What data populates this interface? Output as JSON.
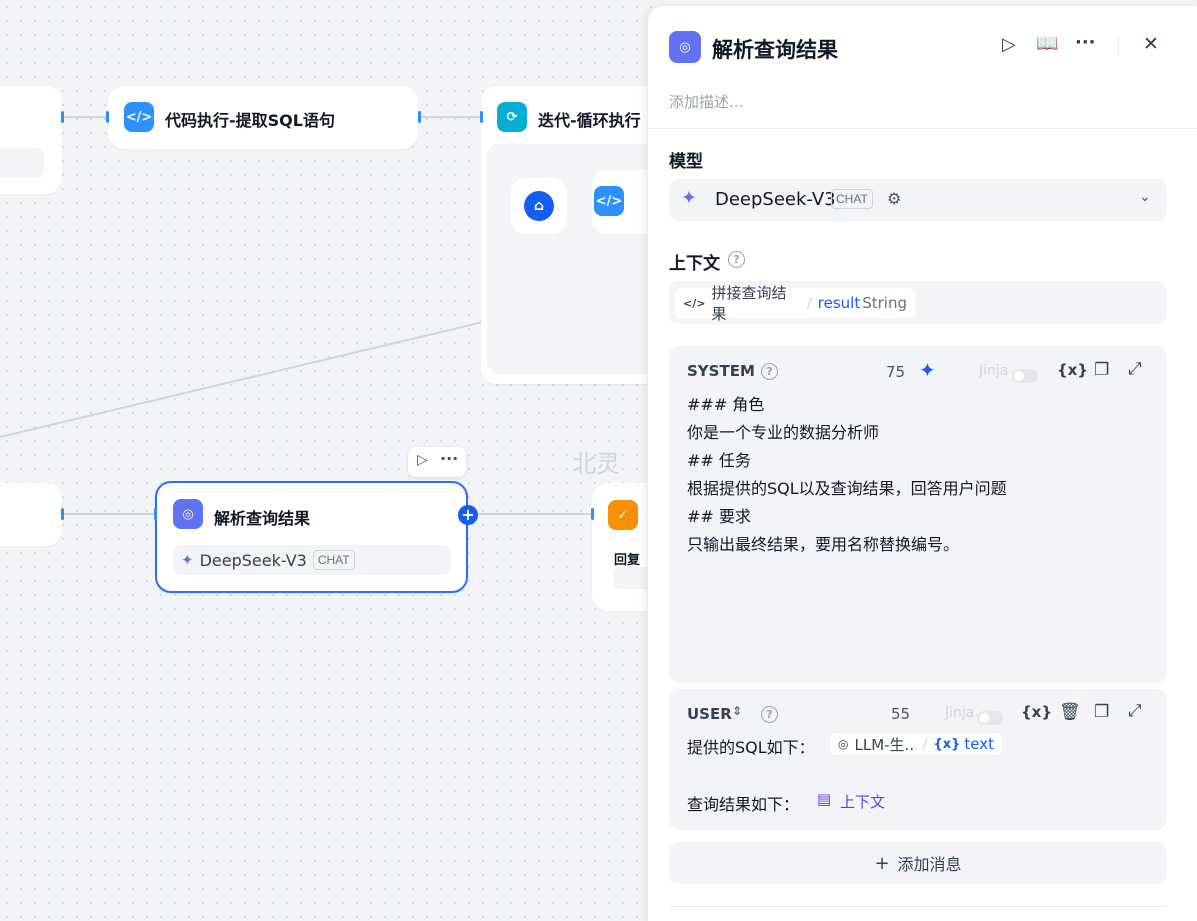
{
  "nodes": {
    "code_exec": {
      "title": "代码执行-提取SQL语句",
      "icon": "code-icon"
    },
    "iteration": {
      "title": "迭代-循环执行",
      "icon": "loop-icon"
    },
    "parse_result": {
      "title": "解析查询结果",
      "icon": "llm-brain-icon",
      "model": "DeepSeek-V3",
      "model_badge": "CHAT"
    },
    "reply": {
      "label": "回复",
      "icon": "reply-icon"
    }
  },
  "watermark": "北灵",
  "panel": {
    "title": "解析查询结果",
    "description_placeholder": "添加描述...",
    "model_section": {
      "label": "模型",
      "model_name": "DeepSeek-V3",
      "badge": "CHAT"
    },
    "context_section": {
      "label": "上下文",
      "var_source": "拼接查询结果",
      "separator": "/",
      "var_name": "result",
      "var_type": "String"
    },
    "system_prompt": {
      "role": "SYSTEM",
      "count": "75",
      "jinja_label": "Jinja",
      "lines": [
        "### 角色",
        "你是一个专业的数据分析师",
        "",
        "## 任务",
        "根据提供的SQL以及查询结果，回答用户问题",
        "",
        "## 要求",
        "只输出最终结果，要用名称替换编号。"
      ]
    },
    "user_prompt": {
      "role": "USER",
      "count": "55",
      "jinja_label": "Jinja",
      "line1_prefix": "提供的SQL如下：",
      "line1_var_source": "LLM-生...",
      "line1_var_sep": "/",
      "line1_var_name": "text",
      "line2_prefix": "查询结果如下：",
      "line2_var": "上下文"
    },
    "add_message": "添加消息"
  },
  "colors": {
    "accent": "#155eef",
    "node_blue": "#2e90fa",
    "node_cyan": "#06aed4",
    "node_indigo": "#6172f3",
    "node_orange": "#f79009",
    "context_purple": "#6938ef"
  }
}
